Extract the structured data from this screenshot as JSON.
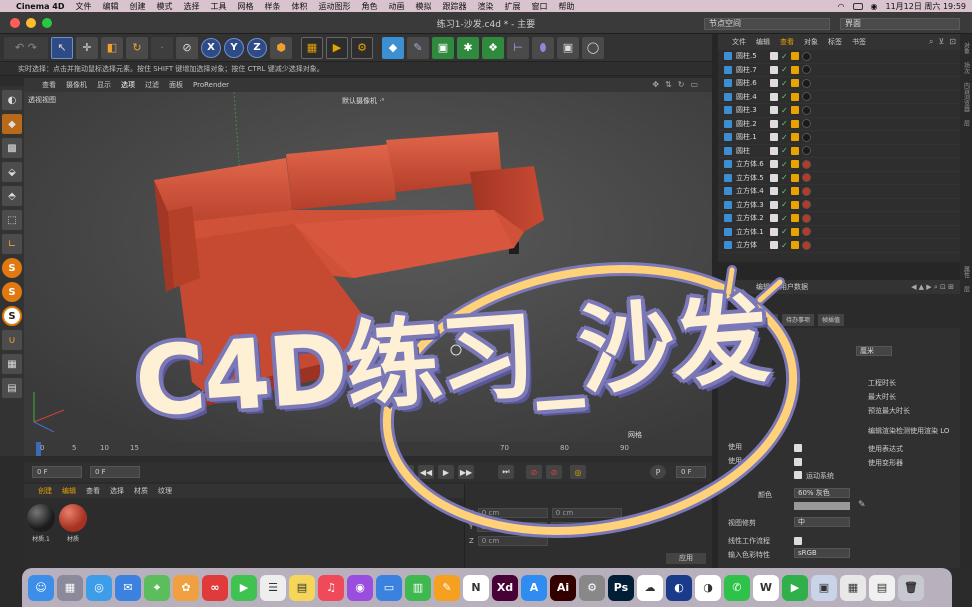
{
  "menubar": {
    "apple": "",
    "app_name": "Cinema 4D",
    "items": [
      "文件",
      "编辑",
      "创建",
      "模式",
      "选择",
      "工具",
      "网格",
      "样条",
      "体积",
      "运动图形",
      "角色",
      "动画",
      "模拟",
      "跟踪器",
      "渲染",
      "扩展",
      "窗口",
      "帮助"
    ],
    "datetime": "11月12日 周六  19:59"
  },
  "window": {
    "title": "练习1-沙发.c4d * - 主要",
    "node_space": "节点空间",
    "layout": "界面"
  },
  "toolbar": {
    "axis_x": "X",
    "axis_y": "Y",
    "axis_z": "Z"
  },
  "hint": "实时选择：点击并拖动鼠标选择元素。按住 SHIFT 键增加选择对象；按住 CTRL 键减少选择对象。",
  "viewport": {
    "menu": [
      "查看",
      "摄像机",
      "显示",
      "选项",
      "过滤",
      "面板",
      "ProRender"
    ],
    "view_name": "透视视图",
    "camera": "默认摄像机 ·⁰",
    "grid": "网格"
  },
  "timeline": {
    "ticks": [
      "0",
      "5",
      "10",
      "15",
      "20",
      "25",
      "30",
      "35",
      "40",
      "45",
      "50",
      "55",
      "60",
      "65",
      "70",
      "75",
      "80",
      "85",
      "90"
    ],
    "current": "0 F",
    "start": "0 F",
    "end_field": "0 F"
  },
  "materials": {
    "menu": [
      "创建",
      "编辑",
      "查看",
      "选择",
      "材质",
      "纹理"
    ],
    "items": [
      {
        "name": "材质.1",
        "color": "#1c1c1c"
      },
      {
        "name": "材质",
        "color": "#a83222"
      }
    ]
  },
  "coords": {
    "x_label": "X",
    "y_label": "Y",
    "z_label": "Z",
    "x_value": "0 cm",
    "y_value": "0 cm",
    "z_value": "0 cm",
    "x2_value": "0 cm",
    "y2_value": "0 cm",
    "apply": "应用"
  },
  "object_manager": {
    "menu": [
      "文件",
      "编辑",
      "查看",
      "对象",
      "标签",
      "书签"
    ],
    "objects": [
      {
        "name": "圆柱.5",
        "material": "black"
      },
      {
        "name": "圆柱.7",
        "material": "black"
      },
      {
        "name": "圆柱.6",
        "material": "black"
      },
      {
        "name": "圆柱.4",
        "material": "black"
      },
      {
        "name": "圆柱.3",
        "material": "black"
      },
      {
        "name": "圆柱.2",
        "material": "black"
      },
      {
        "name": "圆柱.1",
        "material": "black"
      },
      {
        "name": "圆柱",
        "material": "black"
      },
      {
        "name": "立方体.6",
        "material": "red"
      },
      {
        "name": "立方体.5",
        "material": "red"
      },
      {
        "name": "立方体.4",
        "material": "red"
      },
      {
        "name": "立方体.3",
        "material": "red"
      },
      {
        "name": "立方体.2",
        "material": "red"
      },
      {
        "name": "立方体.1",
        "material": "red"
      },
      {
        "name": "立方体",
        "material": "red"
      }
    ]
  },
  "attributes": {
    "menu": [
      "编辑",
      "用户数据"
    ],
    "tabs": [
      "工程设置",
      "参考",
      "待办事项",
      "帧插值"
    ],
    "unit_value": "厘米",
    "labels": {
      "project_length": "工程时长",
      "max_length": "最大时长",
      "preview_max": "预览最大时长",
      "viewport_render": "编辑渲染检测使用渲染 LO",
      "use_expression": "使用表达式",
      "use_deformer": "使用变形器",
      "use_2": "使用",
      "use_3": "使用",
      "motion_system": "运动系统",
      "color_label": "颜色",
      "color_value": "60% 灰色",
      "view_clip": "视图修剪",
      "view_clip_value": "中",
      "linear_workflow": "线性工作流程",
      "input_color": "输入色彩特性",
      "input_color_value": "sRGB"
    }
  },
  "overlay": {
    "text": "C4D练习_沙发"
  },
  "dock": {
    "apps": [
      {
        "icon": "finder-icon",
        "color": "#3d8ee8",
        "glyph": "☺"
      },
      {
        "icon": "launchpad-icon",
        "color": "#8a8a9a",
        "glyph": "▦"
      },
      {
        "icon": "safari-icon",
        "color": "#3d9de8",
        "glyph": "◎"
      },
      {
        "icon": "mail-icon",
        "color": "#3b82e0",
        "glyph": "✉"
      },
      {
        "icon": "maps-icon",
        "color": "#5bbd5b",
        "glyph": "⌖"
      },
      {
        "icon": "photos-icon",
        "color": "#f0a040",
        "glyph": "✿"
      },
      {
        "icon": "creative-cloud-icon",
        "color": "#e03a3a",
        "glyph": "∞"
      },
      {
        "icon": "facetime-icon",
        "color": "#3fc24f",
        "glyph": "▶"
      },
      {
        "icon": "reminders-icon",
        "color": "#eeeeee",
        "glyph": "☰"
      },
      {
        "icon": "notes-icon",
        "color": "#f5d65a",
        "glyph": "▤"
      },
      {
        "icon": "music-icon",
        "color": "#f04a5a",
        "glyph": "♫"
      },
      {
        "icon": "podcasts-icon",
        "color": "#9a4ee0",
        "glyph": "◉"
      },
      {
        "icon": "keynote-icon",
        "color": "#3b82e0",
        "glyph": "▭"
      },
      {
        "icon": "numbers-icon",
        "color": "#3fb84f",
        "glyph": "▥"
      },
      {
        "icon": "pages-icon",
        "color": "#f5a020",
        "glyph": "✎"
      },
      {
        "icon": "notion-icon",
        "color": "#ffffff",
        "glyph": "N"
      },
      {
        "icon": "xd-icon",
        "color": "#470137",
        "glyph": "Xd"
      },
      {
        "icon": "app-store-icon",
        "color": "#2f8cf0",
        "glyph": "A"
      },
      {
        "icon": "illustrator-icon",
        "color": "#330000",
        "glyph": "Ai"
      },
      {
        "icon": "system-preferences-icon",
        "color": "#888888",
        "glyph": "⚙"
      },
      {
        "icon": "photoshop-icon",
        "color": "#001e36",
        "glyph": "Ps"
      },
      {
        "icon": "baidu-netdisk-icon",
        "color": "#ffffff",
        "glyph": "☁"
      },
      {
        "icon": "cinema4d-icon",
        "color": "#1a3a8a",
        "glyph": "◐"
      },
      {
        "icon": "qq-icon",
        "color": "#ffffff",
        "glyph": "◑"
      },
      {
        "icon": "wechat-icon",
        "color": "#2fc24a",
        "glyph": "✆"
      },
      {
        "icon": "wps-icon",
        "color": "#ffffff",
        "glyph": "W"
      },
      {
        "icon": "play-icon",
        "color": "#2fb04a",
        "glyph": "▶"
      },
      {
        "icon": "preview-icon",
        "color": "#c9d4e8",
        "glyph": "▣"
      },
      {
        "icon": "screenshot-icon",
        "color": "#e8e8e8",
        "glyph": "▦"
      },
      {
        "icon": "document-icon",
        "color": "#f0f0f0",
        "glyph": "▤"
      },
      {
        "icon": "trash-icon",
        "color": "#c8c8d0",
        "glyph": "🗑"
      }
    ]
  },
  "colors": {
    "sofa": "#c94a32",
    "accent": "#e8a300",
    "overlay_fill": "#fdf0d4",
    "overlay_stroke": "#7b78b8",
    "ring": "#ffd27a"
  }
}
